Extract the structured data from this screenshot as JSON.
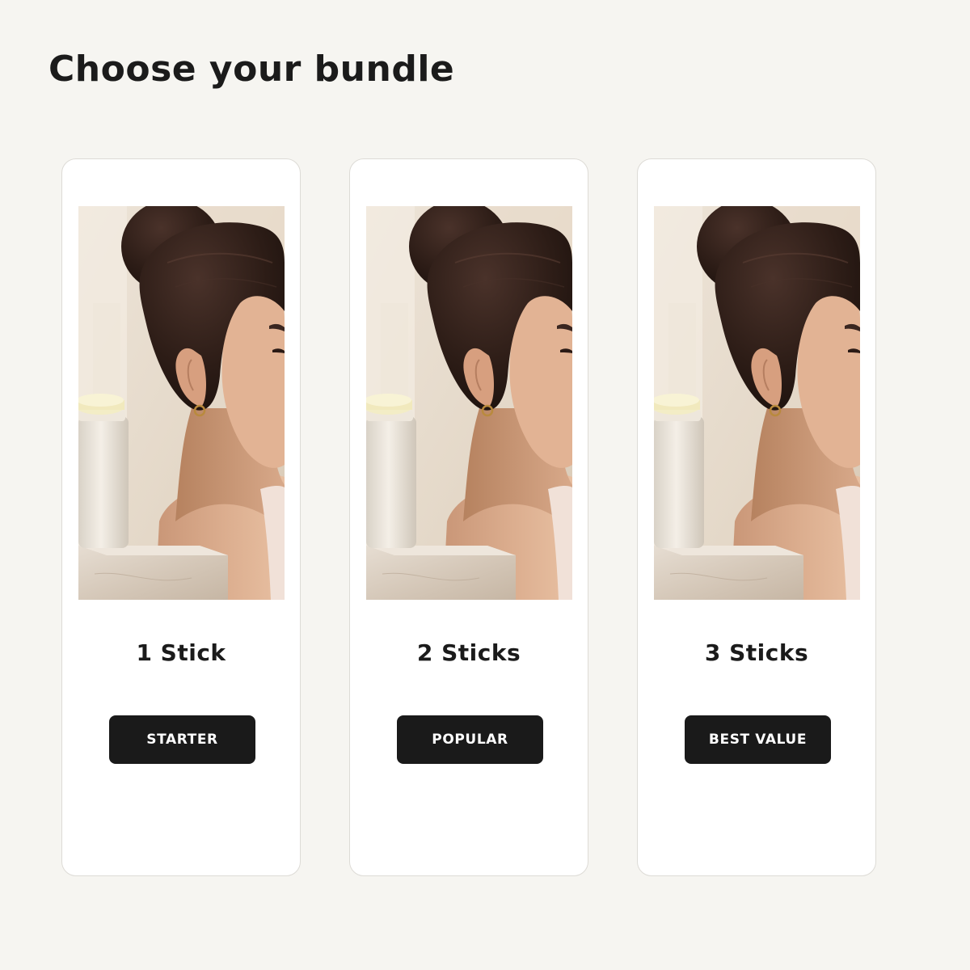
{
  "page": {
    "title": "Choose your bundle"
  },
  "bundles": [
    {
      "title": "1 Stick",
      "badge": "STARTER",
      "image": "product-photo-woman-with-deodorant-stick"
    },
    {
      "title": "2 Sticks",
      "badge": "POPULAR",
      "image": "product-photo-woman-with-deodorant-stick"
    },
    {
      "title": "3 Sticks",
      "badge": "BEST VALUE",
      "image": "product-photo-woman-with-deodorant-stick"
    }
  ],
  "colors": {
    "background": "#f6f5f1",
    "card": "#ffffff",
    "card_border": "#dddbd6",
    "button": "#1a1a1a",
    "button_text": "#ffffff",
    "text": "#1b1b1b"
  }
}
